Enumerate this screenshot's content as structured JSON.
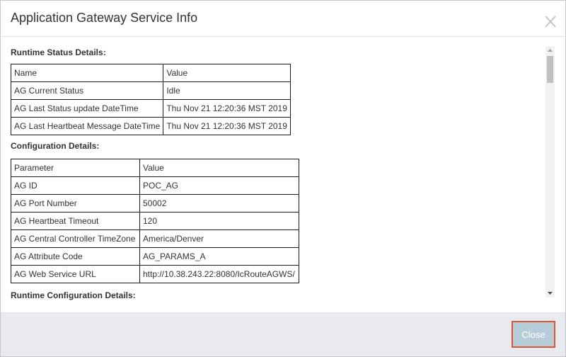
{
  "dialog": {
    "title": "Application Gateway Service Info",
    "close_icon": "close-x-icon",
    "close_button_label": "Close"
  },
  "runtime_status": {
    "heading": "Runtime Status Details:",
    "headers": [
      "Name",
      "Value"
    ],
    "rows": [
      [
        "AG Current Status",
        "Idle"
      ],
      [
        "AG Last Status update DateTime",
        "Thu Nov 21 12:20:36 MST 2019"
      ],
      [
        "AG Last Heartbeat Message DateTime",
        "Thu Nov 21 12:20:36 MST 2019"
      ]
    ]
  },
  "configuration": {
    "heading": "Configuration Details:",
    "headers": [
      "Parameter",
      "Value"
    ],
    "rows": [
      [
        "AG ID",
        "POC_AG"
      ],
      [
        "AG Port Number",
        "50002"
      ],
      [
        "AG Heartbeat Timeout",
        "120"
      ],
      [
        "AG Central Controller TimeZone",
        "America/Denver"
      ],
      [
        "AG Attribute Code",
        "AG_PARAMS_A"
      ],
      [
        "AG Web Service URL",
        "http://10.38.243.22:8080/IcRouteAGWS/"
      ]
    ]
  },
  "runtime_configuration": {
    "heading": "Runtime Configuration Details:"
  },
  "colors": {
    "close_button_bg": "#b7ccd9",
    "close_button_border": "#e0562d",
    "footer_bg": "#e8eaef"
  }
}
